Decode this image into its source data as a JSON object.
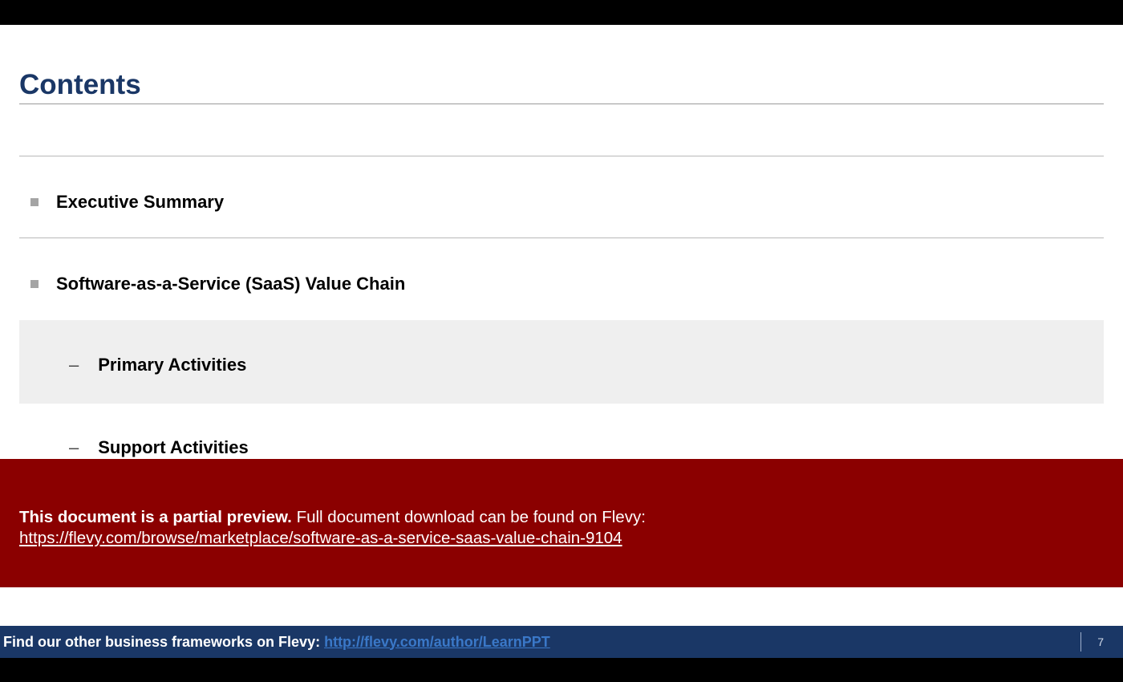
{
  "title": "Contents",
  "items": [
    {
      "label": "Executive Summary"
    },
    {
      "label": "Software-as-a-Service (SaaS) Value Chain"
    },
    {
      "label": "Primary Activities",
      "indent": true,
      "highlight": true
    },
    {
      "label": "Support Activities",
      "indent": true
    }
  ],
  "preview": {
    "bold": "This document is a partial preview.",
    "rest": "  Full document download can be found on Flevy:",
    "url": "https://flevy.com/browse/marketplace/software-as-a-service-saas-value-chain-9104"
  },
  "footer": {
    "text": "Find our other business frameworks on Flevy: ",
    "link": "http://flevy.com/author/LearnPPT",
    "page": "7"
  }
}
